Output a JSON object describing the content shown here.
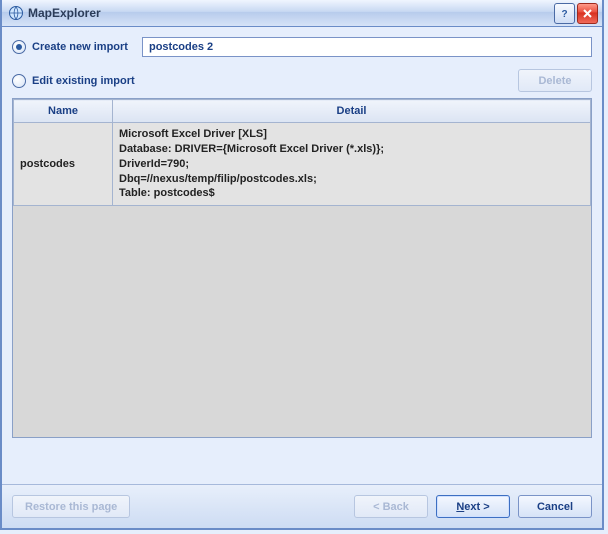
{
  "window": {
    "title": "MapExplorer"
  },
  "options": {
    "create_label": "Create new import",
    "edit_label": "Edit existing import",
    "selected": "create"
  },
  "input": {
    "value": "postcodes 2"
  },
  "buttons": {
    "delete": "Delete",
    "restore": "Restore this page",
    "back": "< Back",
    "cancel": "Cancel",
    "next_prefix": "N",
    "next_rest": "ext  >"
  },
  "table": {
    "headers": {
      "name": "Name",
      "detail": "Detail"
    },
    "rows": [
      {
        "name": "postcodes",
        "detail_lines": [
          "Microsoft Excel Driver [XLS]",
          "Database: DRIVER={Microsoft Excel Driver (*.xls)};",
          "DriverId=790;",
          "Dbq=//nexus/temp/filip/postcodes.xls;",
          "Table: postcodes$"
        ]
      }
    ]
  }
}
